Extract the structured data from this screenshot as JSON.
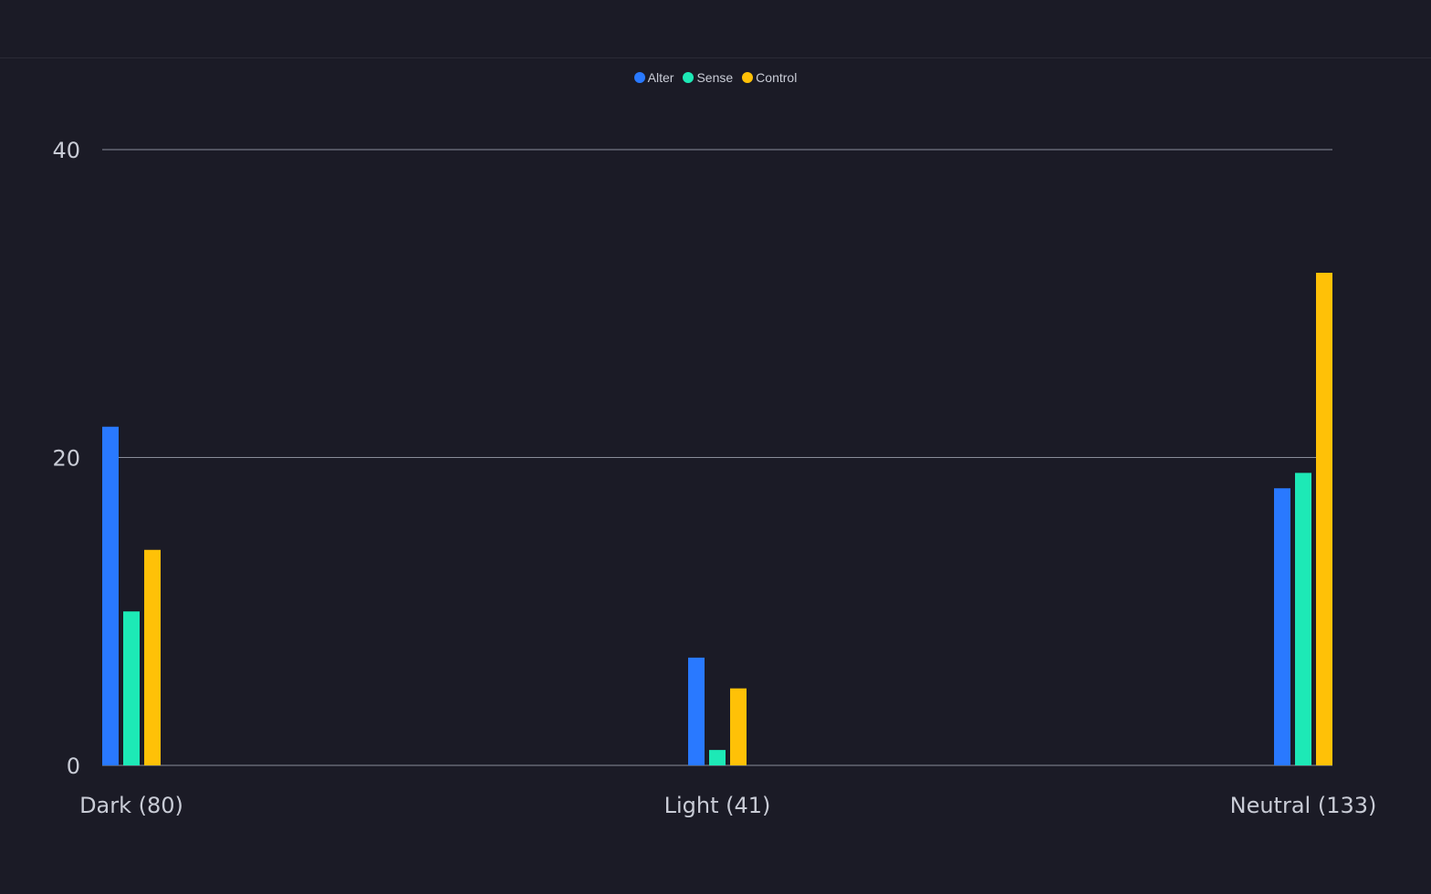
{
  "chart_data": {
    "type": "bar",
    "title": "",
    "xlabel": "",
    "ylabel": "",
    "categories": [
      "Dark (80)",
      "Light (41)",
      "Neutral (133)"
    ],
    "series": [
      {
        "name": "Alter",
        "values": [
          22,
          7,
          18
        ],
        "color": "#2979ff"
      },
      {
        "name": "Sense",
        "values": [
          10,
          1,
          19
        ],
        "color": "#1de9b6"
      },
      {
        "name": "Control",
        "values": [
          14,
          5,
          32
        ],
        "color": "#ffc107"
      }
    ],
    "ylim": [
      0,
      40
    ],
    "yticks": [
      "0",
      "20",
      "40"
    ],
    "legend_position": "top-center",
    "grid": true
  },
  "colors": {
    "background": "#1b1b26",
    "grid": "#8a8d99",
    "text": "#c9ccd6"
  }
}
